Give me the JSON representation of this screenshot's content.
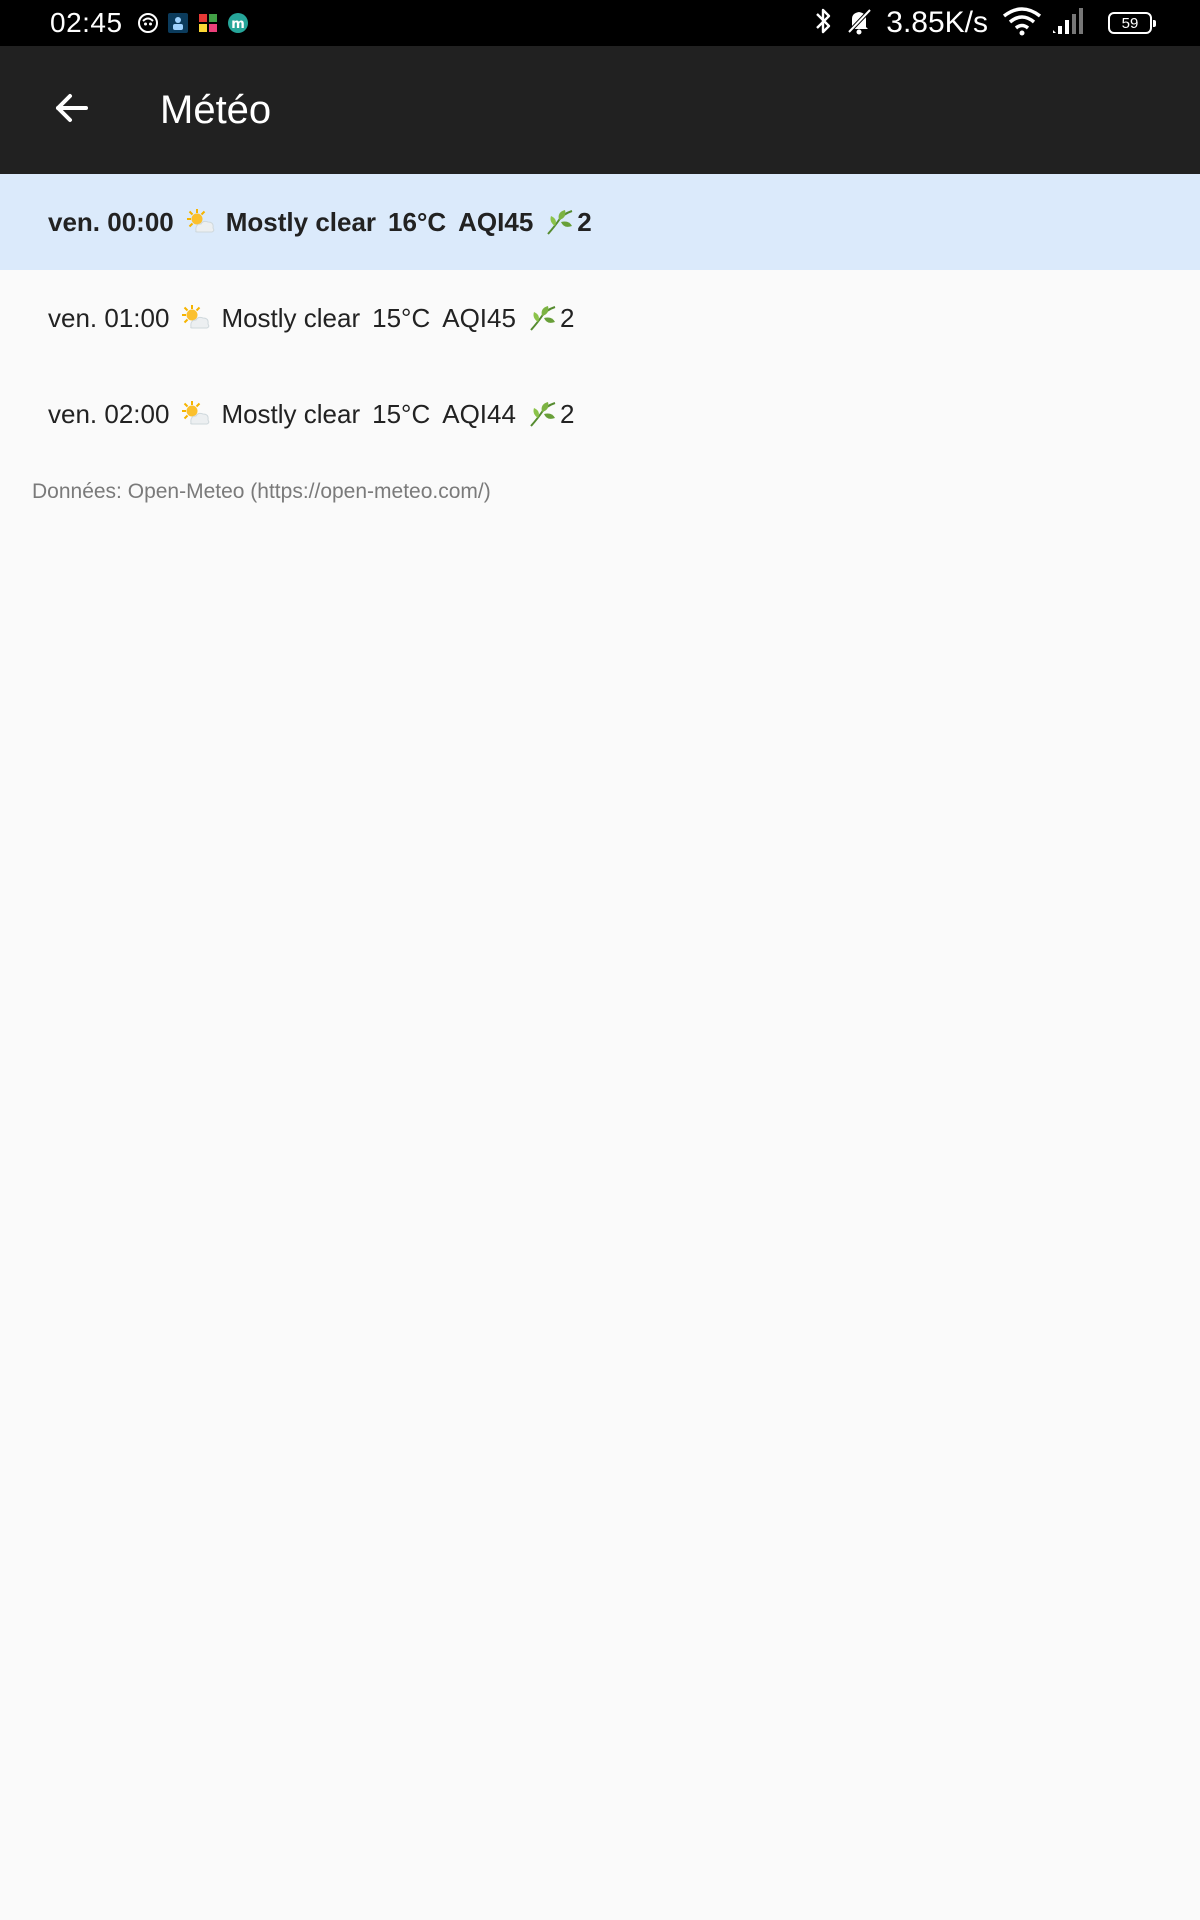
{
  "status_bar": {
    "time": "02:45",
    "network_speed": "3.85K/s",
    "battery_level": "59",
    "icons": [
      "app-icon-1",
      "app-icon-2",
      "app-icon-3",
      "app-icon-4",
      "bluetooth-icon",
      "bell-muted-icon",
      "wifi-icon",
      "signal-icon",
      "battery-icon"
    ]
  },
  "app_bar": {
    "title": "Météo",
    "back_icon": "arrow-left-icon"
  },
  "forecast": [
    {
      "time": "ven. 00:00",
      "condition": "Mostly clear",
      "temperature": "16°C",
      "aqi": "AQI45",
      "pollen": "2",
      "icon": "sun-behind-cloud-icon",
      "selected": true
    },
    {
      "time": "ven. 01:00",
      "condition": "Mostly clear",
      "temperature": "15°C",
      "aqi": "AQI45",
      "pollen": "2",
      "icon": "sun-behind-cloud-icon",
      "selected": false
    },
    {
      "time": "ven. 02:00",
      "condition": "Mostly clear",
      "temperature": "15°C",
      "aqi": "AQI44",
      "pollen": "2",
      "icon": "sun-behind-cloud-icon",
      "selected": false
    }
  ],
  "attribution": "Données: Open-Meteo (https://open-meteo.com/)",
  "colors": {
    "status_bar": "#000000",
    "app_bar": "#212121",
    "selected_row": "#dbeafb",
    "background": "#fafafa",
    "leaf_green": "#4caf50"
  }
}
